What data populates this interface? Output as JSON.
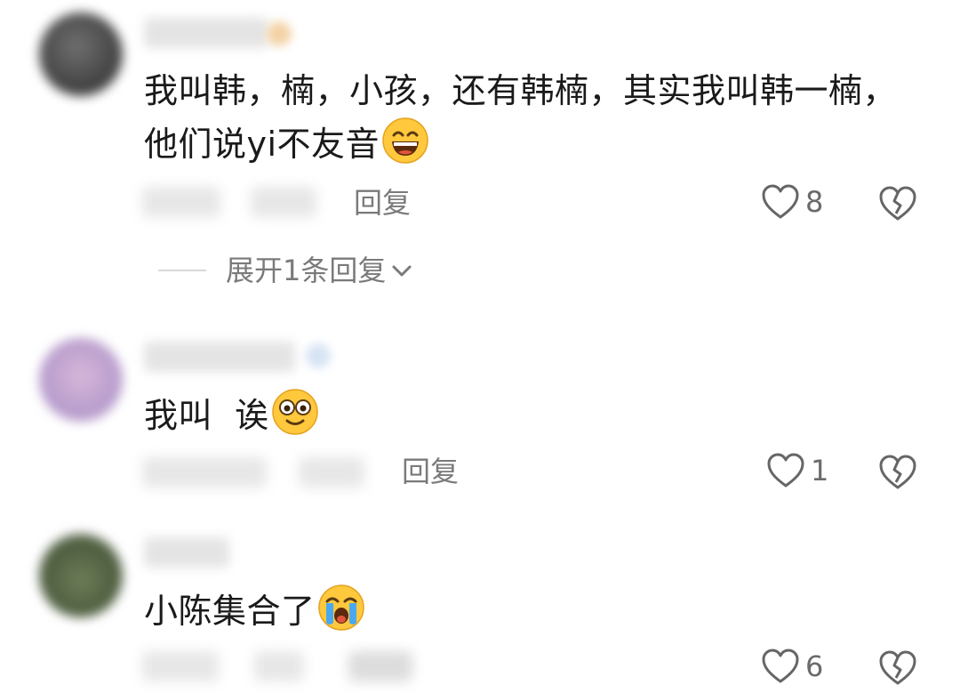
{
  "comments": [
    {
      "text_line1": "我叫韩，楠，小孩，还有韩楠，其实我叫韩一楠，",
      "text_line2": "他们说yi不友音",
      "emoji": "grinning-sweat-emoji",
      "reply_label": "回复",
      "like_count": "8",
      "expand_label": "展开1条回复"
    },
    {
      "text": "我叫  诶",
      "emoji": "wide-eyes-emoji",
      "reply_label": "回复",
      "like_count": "1"
    },
    {
      "text": "小陈集合了",
      "emoji": "crying-emoji",
      "reply_label": "回复",
      "like_count": "6"
    }
  ],
  "colors": {
    "text": "#1a1a1a",
    "secondary": "#7a7a7a",
    "icon": "#666666",
    "emoji_yellow": "#ffc83d"
  }
}
